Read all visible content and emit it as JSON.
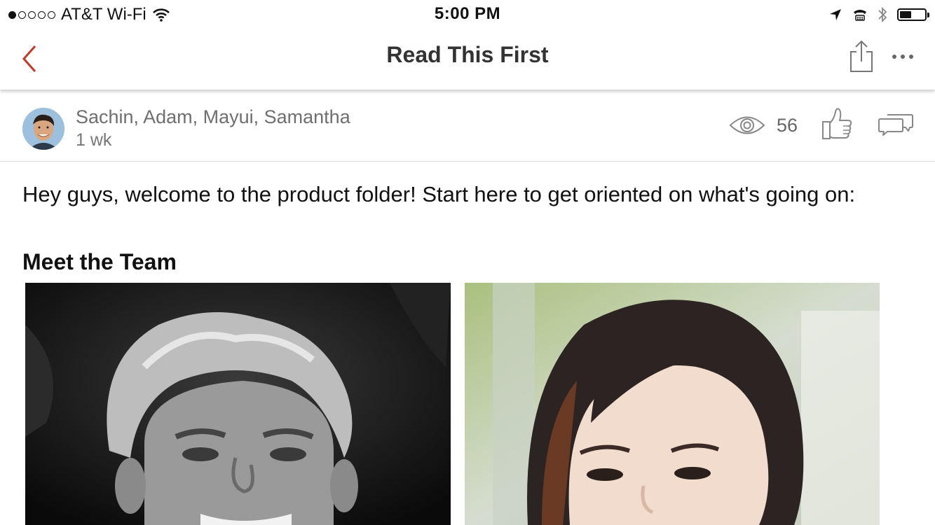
{
  "status_bar": {
    "carrier": "AT&T Wi-Fi",
    "time": "5:00 PM",
    "signal_icon": "signal-dots-icon",
    "wifi_icon": "wifi-icon",
    "location_icon": "location-arrow-icon",
    "tty_icon": "tty-icon",
    "bluetooth_icon": "bluetooth-icon",
    "battery_icon": "battery-icon",
    "battery_level": 0.42
  },
  "nav": {
    "title": "Read This First",
    "back_icon": "chevron-left-icon",
    "share_icon": "share-icon",
    "more_icon": "more-icon",
    "accent_color": "#c0392b"
  },
  "post": {
    "authors": "Sachin, Adam, Mayui, Samantha",
    "time": "1 wk",
    "views": "56",
    "view_icon": "eye-icon",
    "like_icon": "thumbs-up-icon",
    "comment_icon": "comments-icon"
  },
  "content": {
    "intro": "Hey guys, welcome to the product folder! Start here to get oriented on what's going on:",
    "section_heading": "Meet the Team"
  }
}
